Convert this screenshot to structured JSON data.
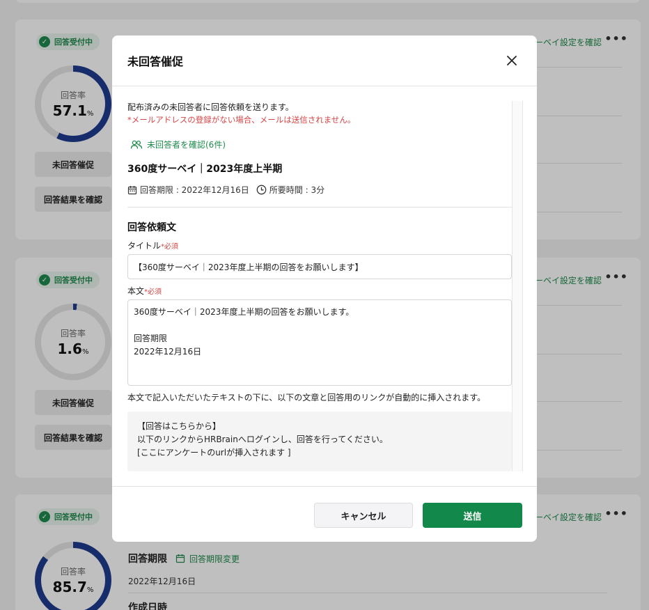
{
  "background": {
    "cards": [
      {
        "status": "回答受付中",
        "rate_label": "回答率",
        "rate": "57.1",
        "rate_value": 57.1,
        "unit": "%",
        "remind_label": "未回答催促",
        "results_label": "回答結果を確認",
        "settings_link": "サーベイ設定を確認"
      },
      {
        "status": "回答受付中",
        "rate_label": "回答率",
        "rate": "1.6",
        "rate_value": 1.6,
        "unit": "%",
        "remind_label": "未回答催促",
        "results_label": "回答結果を確認",
        "settings_link": "サーベイ設定を確認"
      },
      {
        "status": "回答受付中",
        "rate_label": "回答率",
        "rate": "85.7",
        "rate_value": 85.7,
        "unit": "%",
        "settings_link": "サーベイ設定を確認",
        "deadline_heading": "回答期限",
        "deadline_change": "回答期限変更",
        "deadline_date": "2022年12月16日",
        "created_heading": "作成日時"
      }
    ]
  },
  "modal": {
    "title": "未回答催促",
    "intro": "配布済みの未回答者に回答依頼を送ります。",
    "warning": "*メールアドレスの登録がない場合、メールは送信されません。",
    "confirm_link": "未回答者を確認(6件)",
    "survey_name": "360度サーベイ｜2023年度上半期",
    "deadline": "回答期限 : 2022年12月16日",
    "duration": "所要時間 : 3分",
    "section_title": "回答依頼文",
    "title_label": "タイトル",
    "required": "*必須",
    "title_value": "【360度サーベイ｜2023年度上半期の回答をお願いします】",
    "body_label": "本文",
    "body_lines": [
      "360度サーベイ｜2023年度上半期の回答をお願いします。",
      "",
      "回答期限",
      "2022年12月16日"
    ],
    "note": "本文で記入いただいたテキストの下に、以下の文章と回答用のリンクが自動的に挿入されます。",
    "auto_lines": [
      "【回答はこちらから】",
      "以下のリンクからHRBrainへログインし、回答を行ってください。",
      "[ここにアンケートのurlが挿入されます ]"
    ],
    "cancel_label": "キャンセル",
    "send_label": "送信"
  },
  "colors": {
    "accent": "#12894a",
    "gauge": "#1f3c8f",
    "required": "#d64545"
  }
}
